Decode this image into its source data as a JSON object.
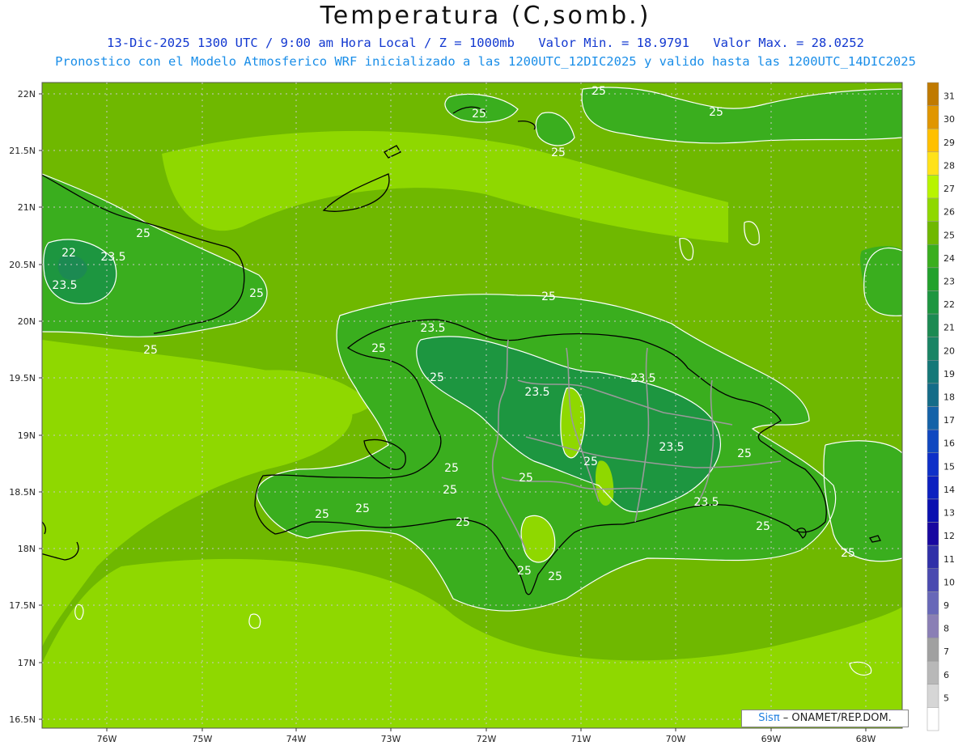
{
  "header": {
    "title": "Temperatura (C,somb.)",
    "datetime": "13-Dic-2025  1300 UTC / 9:00 am Hora Local / Z = 1000mb",
    "min_label": "Valor Min. = 18.9791",
    "max_label": "Valor Max. = 28.0252",
    "model_line": "Pronostico con el Modelo Atmosferico WRF inicializado a las 1200UTC_12DIC2025 y valido hasta las  1200UTC_14DIC2025"
  },
  "map": {
    "lat_labels": [
      "22N",
      "21.5N",
      "21N",
      "20.5N",
      "20N",
      "19.5N",
      "19N",
      "18.5N",
      "18N",
      "17.5N",
      "17N",
      "16.5N"
    ],
    "lon_labels": [
      "76W",
      "75W",
      "74W",
      "73W",
      "72W",
      "71W",
      "70W",
      "69W",
      "68W"
    ],
    "contour_labels": [
      "25",
      "25",
      "25",
      "25",
      "25",
      "25",
      "25",
      "25",
      "25",
      "25",
      "25",
      "25",
      "25",
      "25",
      "25",
      "25",
      "25",
      "25",
      "25",
      "25",
      "25",
      "25",
      "23.5",
      "23.5",
      "23.5",
      "23.5",
      "23.5",
      "23.5",
      "23.5",
      "22"
    ],
    "value_min": 18.9791,
    "value_max": 28.0252
  },
  "colorbar": {
    "levels": [
      "31",
      "30",
      "29",
      "28",
      "27",
      "26",
      "25",
      "24",
      "23",
      "22",
      "21",
      "20",
      "19",
      "18",
      "17",
      "16",
      "15",
      "14",
      "13",
      "12",
      "11",
      "10",
      "9",
      "8",
      "7",
      "6",
      "5"
    ],
    "colors": [
      "#c07a00",
      "#e09600",
      "#ffc000",
      "#ffe21a",
      "#b8f400",
      "#8fd800",
      "#6fb800",
      "#3aae1e",
      "#22a12c",
      "#1d9640",
      "#1c8a52",
      "#1a8464",
      "#157878",
      "#146c88",
      "#1462a8",
      "#1048c0",
      "#0e30c8",
      "#0c20c0",
      "#0a10b0",
      "#1808a0",
      "#3030a8",
      "#4a4ab0",
      "#6868b8",
      "#8a7fb5",
      "#a0a0a0",
      "#b8b8b8",
      "#d6d6d6",
      "#ffffff"
    ]
  },
  "credit": {
    "brand": "Sisπ",
    "org": " – ONAMET/REP.DOM."
  }
}
